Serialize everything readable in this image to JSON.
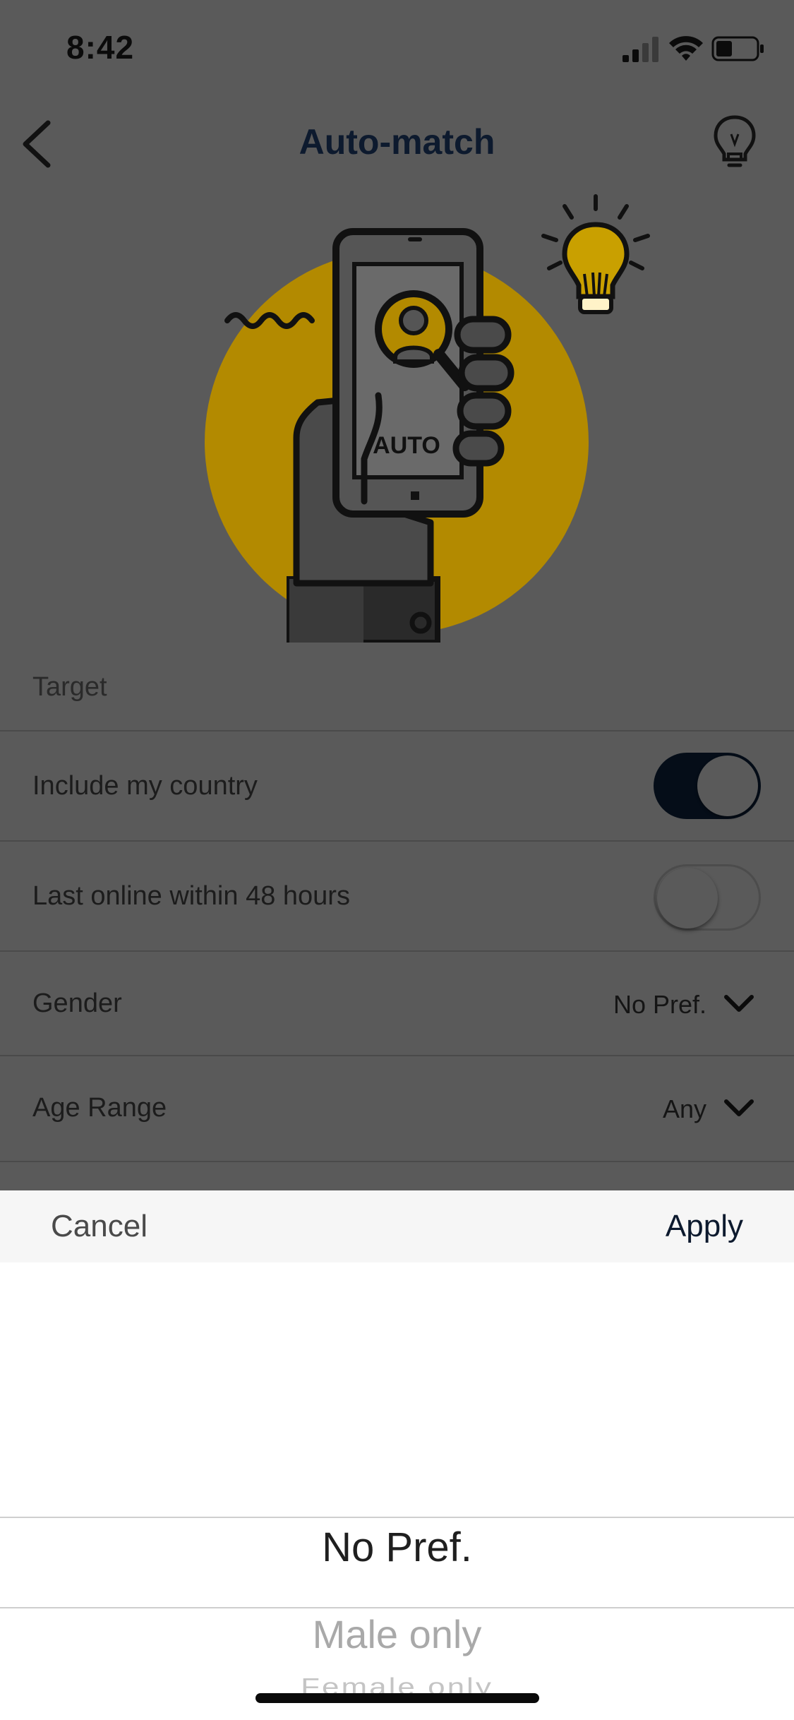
{
  "status_bar": {
    "time": "8:42"
  },
  "nav": {
    "title": "Auto-match"
  },
  "illustration": {
    "screen_text": "AUTO",
    "accent_color": "#b38a00"
  },
  "settings": {
    "section_label": "Target",
    "include_country": {
      "label": "Include my country",
      "enabled": true
    },
    "last_online": {
      "label": "Last online within 48 hours",
      "enabled": false
    },
    "gender": {
      "label": "Gender",
      "value": "No Pref."
    },
    "age_range": {
      "label": "Age Range",
      "value": "Any"
    }
  },
  "picker": {
    "cancel_label": "Cancel",
    "apply_label": "Apply",
    "options": [
      "No Pref.",
      "Male only",
      "Female only"
    ],
    "selected": "No Pref."
  }
}
